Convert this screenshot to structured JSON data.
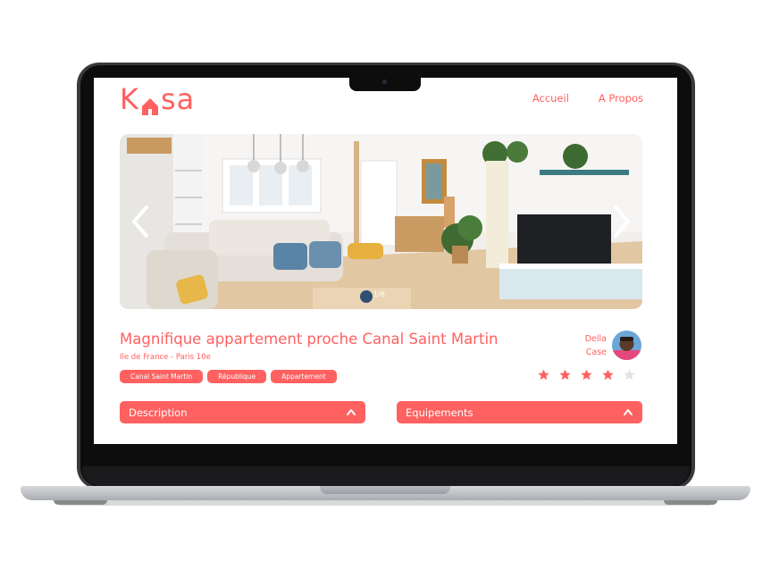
{
  "brand": {
    "logo_left": "K",
    "logo_right": "sa",
    "color": "#ff6060"
  },
  "nav": {
    "items": [
      {
        "label": "Accueil"
      },
      {
        "label": "A Propos"
      }
    ]
  },
  "carousel": {
    "counter": "1/6",
    "prev_icon": "chevron-left-icon",
    "next_icon": "chevron-right-icon"
  },
  "listing": {
    "title": "Magnifique appartement proche Canal Saint Martin",
    "location": "Ile de France - Paris 10e",
    "tags": [
      "Canal Saint Martin",
      "République",
      "Appartement"
    ],
    "host": {
      "first_name": "Della",
      "last_name": "Case"
    },
    "rating": 4,
    "rating_max": 5
  },
  "collapses": [
    {
      "label": "Description",
      "icon": "chevron-up-icon"
    },
    {
      "label": "Equipements",
      "icon": "chevron-up-icon"
    }
  ],
  "colors": {
    "accent": "#ff6060",
    "star_empty": "#e3e3e3",
    "text_on_accent": "#ffffff"
  }
}
